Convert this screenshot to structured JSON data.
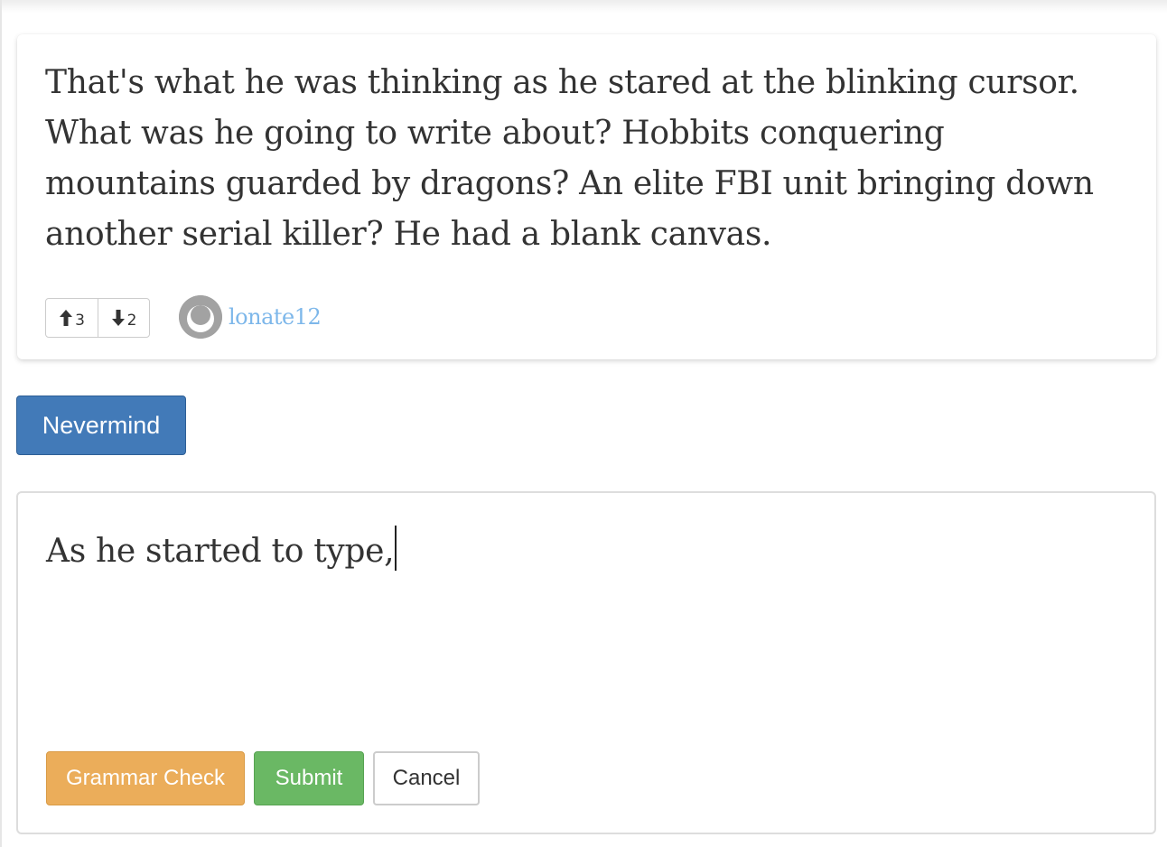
{
  "story": {
    "text": "That's what he was thinking as he stared at the blinking cursor. What was he going to write about? Hobbits conquering mountains guarded by dragons? An elite FBI unit bringing down another serial killer? He had a blank canvas.",
    "upvotes": "3",
    "downvotes": "2",
    "author": "lonate12"
  },
  "actions": {
    "nevermind_label": "Nevermind"
  },
  "editor": {
    "value": "As he started to type,",
    "grammar_label": "Grammar Check",
    "submit_label": "Submit",
    "cancel_label": "Cancel"
  },
  "colors": {
    "primary": "#427ab8",
    "warning": "#ebad5a",
    "success": "#6ab864",
    "link": "#7db7ea"
  },
  "icons": {
    "upvote": "arrow-up-icon",
    "downvote": "arrow-down-icon",
    "avatar": "user-avatar-icon"
  }
}
